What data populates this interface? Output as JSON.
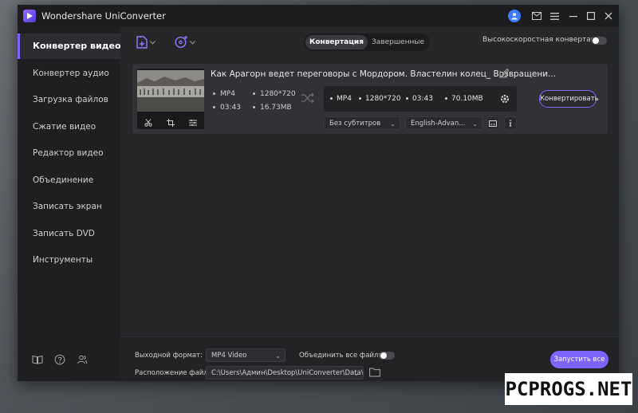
{
  "window": {
    "title": "Wondershare UniConverter"
  },
  "sidebar": {
    "items": [
      {
        "label": "Конвертер видео",
        "active": true
      },
      {
        "label": "Конвертер аудио"
      },
      {
        "label": "Загрузка файлов"
      },
      {
        "label": "Сжатие видео"
      },
      {
        "label": "Редактор видео"
      },
      {
        "label": "Объединение"
      },
      {
        "label": "Записать экран"
      },
      {
        "label": "Записать DVD"
      },
      {
        "label": "Инструменты"
      }
    ]
  },
  "toolbar": {
    "tabs": [
      {
        "label": "Конвертация",
        "active": true
      },
      {
        "label": "Завершенные"
      }
    ],
    "high_speed_label": "Высокоскоростная конвертация",
    "high_speed_on": false
  },
  "file": {
    "title": "Как Арагорн ведет переговоры с Мордором. Властелин колец_ Возвращени...",
    "source": {
      "format": "MP4",
      "resolution": "1280*720",
      "duration": "03:43",
      "size": "16.73MB"
    },
    "target": {
      "format": "MP4",
      "resolution": "1280*720",
      "duration": "03:43",
      "size": "70.10MB"
    },
    "subtitles": "Без субтитров",
    "audio": "English-Advan...",
    "convert_label": "Конвертировать"
  },
  "bottom": {
    "output_format_label": "Выходной формат:",
    "output_format_value": "MP4 Video",
    "merge_label": "Объединить все файлы:",
    "merge_on": false,
    "location_label": "Расположение файла:",
    "location_value": "C:\\Users\\Админ\\Desktop\\UniConverter\\Data\\",
    "start_all_label": "Запустить все"
  },
  "watermark": "PCPROGS.NET",
  "colors": {
    "accent": "#7e63ff",
    "user_avatar": "#3b7bff"
  }
}
